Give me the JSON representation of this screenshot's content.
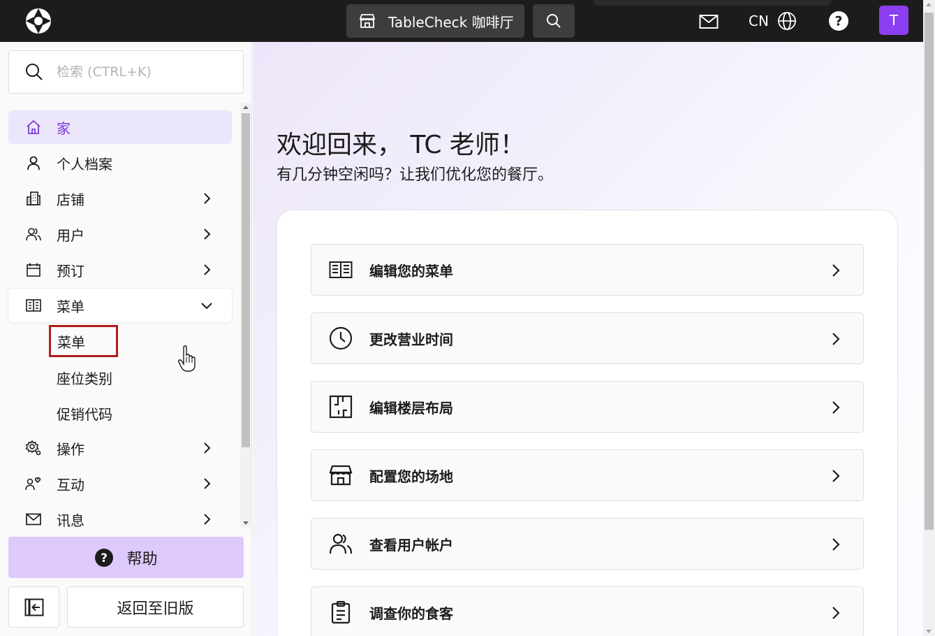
{
  "topbar": {
    "venue_name": "TableCheck 咖啡厅",
    "language": "CN",
    "avatar_initial": "T",
    "accent_color": "#8b3ff0"
  },
  "sidebar": {
    "search_placeholder": "检索 (CTRL+K)",
    "items": [
      {
        "label": "家",
        "icon": "home-icon",
        "active": true
      },
      {
        "label": "个人档案",
        "icon": "person-icon"
      },
      {
        "label": "店铺",
        "icon": "building-icon",
        "chevron": "right"
      },
      {
        "label": "用户",
        "icon": "users-icon",
        "chevron": "right"
      },
      {
        "label": "预订",
        "icon": "calendar-icon",
        "chevron": "right"
      },
      {
        "label": "菜单",
        "icon": "menu-book-icon",
        "chevron": "down",
        "expanded": true
      },
      {
        "label": "操作",
        "icon": "gear-cog-icon",
        "chevron": "right"
      },
      {
        "label": "互动",
        "icon": "people-heart-icon",
        "chevron": "right"
      },
      {
        "label": "讯息",
        "icon": "mail-icon",
        "chevron": "right"
      }
    ],
    "sub_items": [
      {
        "label": "菜单",
        "highlighted": true
      },
      {
        "label": "座位类别"
      },
      {
        "label": "促销代码"
      }
    ],
    "help_label": "帮助",
    "legacy_label": "返回至旧版"
  },
  "main": {
    "welcome": "欢迎回来， TC 老师！",
    "subline": "有几分钟空闲吗？让我们优化您的餐厅。",
    "actions": [
      {
        "label": "编辑您的菜单",
        "icon": "menu-book-icon"
      },
      {
        "label": "更改营业时间",
        "icon": "clock-icon"
      },
      {
        "label": "编辑楼层布局",
        "icon": "floor-plan-icon"
      },
      {
        "label": "配置您的场地",
        "icon": "storefront-icon"
      },
      {
        "label": "查看用户帐户",
        "icon": "users-icon"
      },
      {
        "label": "调查你的食客",
        "icon": "clipboard-icon"
      }
    ]
  }
}
